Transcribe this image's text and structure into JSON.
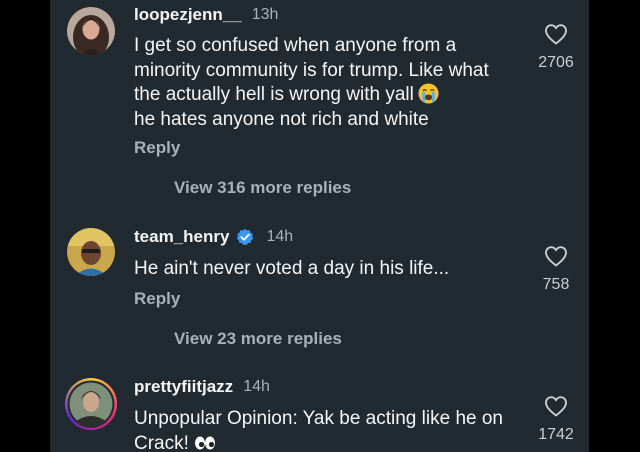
{
  "comments": [
    {
      "username": "loopezjenn__",
      "time": "13h",
      "text": "I get so confused when anyone from a minority community is for trump. Like what the actually hell is wrong with yall",
      "text_end": "he hates anyone not rich and white",
      "emoji": "loudly-crying-face",
      "reply_label": "Reply",
      "view_more_label": "View 316 more replies",
      "likes": "2706",
      "verified": false
    },
    {
      "username": "team_henry",
      "time": "14h",
      "text": "He ain't never voted a day in his life...",
      "reply_label": "Reply",
      "view_more_label": "View 23 more replies",
      "likes": "758",
      "verified": true
    },
    {
      "username": "prettyfiitjazz",
      "time": "14h",
      "text": "Unpopular Opinion: Yak be acting like he on Crack!",
      "emoji": "eyes",
      "likes": "1742",
      "verified": false
    }
  ],
  "colors": {
    "background": "#000000",
    "panel": "#212a31",
    "text_primary": "#f5f5f5",
    "text_secondary": "#a8b1b8",
    "verified_badge": "#3897f0"
  }
}
